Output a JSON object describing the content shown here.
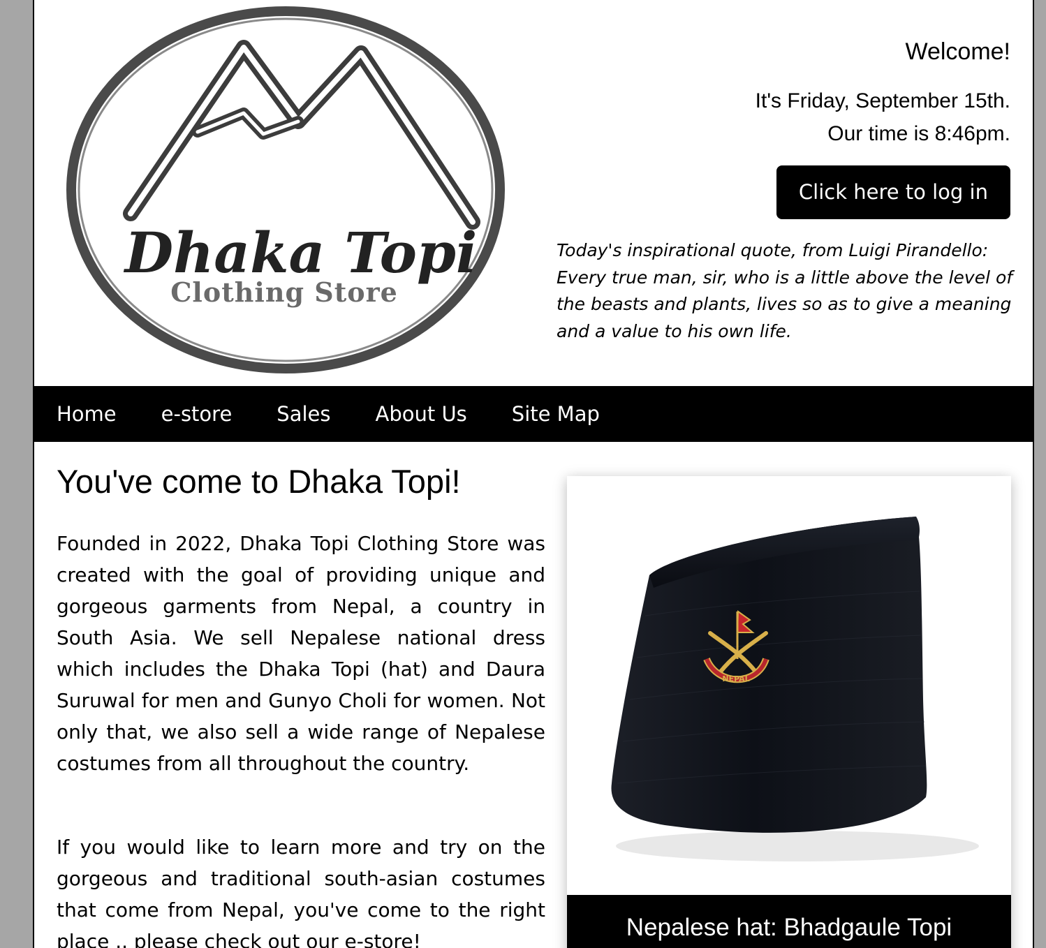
{
  "logo": {
    "brand_script": "Dhaka Topi",
    "brand_sub": "Clothing Store"
  },
  "header": {
    "welcome": "Welcome!",
    "date_line": "It's Friday, September 15th.",
    "time_line": "Our time is 8:46pm.",
    "login_label": "Click here to log in",
    "quote": "Today's inspirational quote, from Luigi Pirandello: Every true man, sir, who is a little above the level of the beasts and plants, lives so as to give a meaning and a value to his own life."
  },
  "nav": {
    "items": [
      {
        "label": "Home"
      },
      {
        "label": "e-store"
      },
      {
        "label": "Sales"
      },
      {
        "label": "About Us"
      },
      {
        "label": "Site Map"
      }
    ]
  },
  "main": {
    "title": "You've come to Dhaka Topi!",
    "paragraph1": "Founded in 2022, Dhaka Topi Clothing Store was created with the goal of providing unique and gorgeous garments from Nepal, a country in South Asia. We sell Nepalese national dress which includes the Dhaka Topi (hat) and Daura Suruwal for men and Gunyo Choli for women. Not only that, we also sell a wide range of Nepalese costumes from all throughout the country.",
    "paragraph2": "If you would like to learn more and try on the gorgeous and traditional south-asian costumes that come from Nepal, you've come to the right place .. please check out our e-store!"
  },
  "figure": {
    "caption": "Nepalese hat: Bhadgaule Topi",
    "pin_text": "NEPAL"
  },
  "colors": {
    "page_bg": "#a6a6a6",
    "content_bg": "#ffffff",
    "nav_bg": "#000000",
    "button_bg": "#000000",
    "logo_gray": "#3c3c3c"
  }
}
